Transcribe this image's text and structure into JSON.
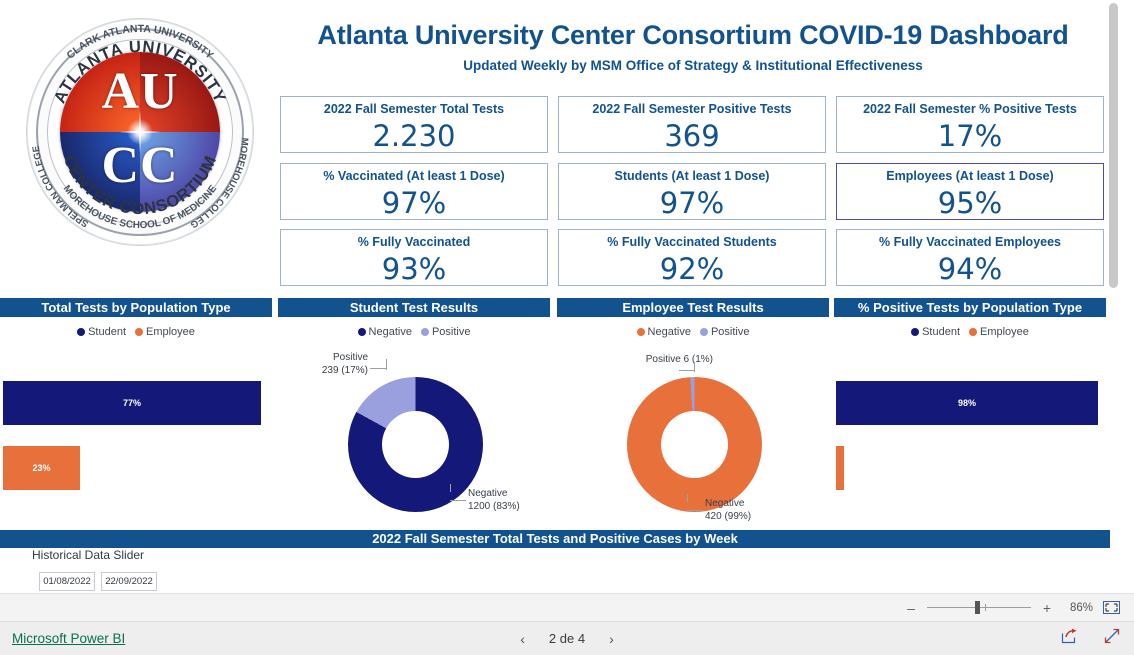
{
  "header": {
    "title": "Atlanta University Center Consortium COVID-19 Dashboard",
    "subtitle": "Updated Weekly by MSM Office of Strategy & Institutional Effectiveness"
  },
  "logo": {
    "inner_text_top": "ATLANTA UNIVERSITY",
    "inner_text_bottom": "CENTER CONSORTIUM",
    "outer_text_top": "CLARK ATLANTA UNIVERSITY",
    "outer_text_left": "SPELMAN COLLEGE",
    "outer_text_right": "MOREHOUSE COLLEGE",
    "outer_text_bottom": "MOREHOUSE SCHOOL OF MEDICINE",
    "monogram_line1": "AU",
    "monogram_line2": "CC"
  },
  "kpis": [
    {
      "label": "2022 Fall Semester Total Tests",
      "value": "2.230",
      "focused": false
    },
    {
      "label": "2022 Fall Semester Positive Tests",
      "value": "369",
      "focused": false
    },
    {
      "label": "2022 Fall Semester % Positive Tests",
      "value": "17%",
      "focused": false
    },
    {
      "label": "% Vaccinated (At least 1 Dose)",
      "value": "97%",
      "focused": false
    },
    {
      "label": "Students (At least 1 Dose)",
      "value": "97%",
      "focused": false
    },
    {
      "label": "Employees (At least 1 Dose)",
      "value": "95%",
      "focused": true
    },
    {
      "label": "% Fully Vaccinated",
      "value": "93%",
      "focused": false
    },
    {
      "label": "% Fully Vaccinated Students",
      "value": "92%",
      "focused": false
    },
    {
      "label": "% Fully Vaccinated Employees",
      "value": "94%",
      "focused": false
    }
  ],
  "panels": {
    "total_tests_by_population": "Total Tests by Population Type",
    "student_test_results": "Student Test Results",
    "employee_test_results": "Employee Test Results",
    "pct_positive_by_population": "% Positive Tests by Population Type",
    "weekly_trend": "2022 Fall Semester Total Tests and Positive Cases by Week"
  },
  "slider": {
    "label": "Historical Data Slider",
    "start_date": "01/08/2022",
    "end_date": "22/09/2022"
  },
  "zoombar": {
    "minus": "–",
    "plus": "+",
    "percent": "86%",
    "fit_icon": "fit-to-page-icon"
  },
  "footer": {
    "brand": "Microsoft Power BI",
    "prev_icon": "chevron-left-icon",
    "page_indicator": "2 de 4",
    "next_icon": "chevron-right-icon",
    "share_icon": "share-icon",
    "fullscreen_icon": "fullscreen-icon"
  },
  "colors": {
    "header_blue": "#11528f",
    "navy": "#141878",
    "orange": "#E8703A",
    "light_purple": "#9aa0dd",
    "card_border": "#9db3cc",
    "focus_border": "#4b4f9e"
  },
  "chart_data": [
    {
      "type": "bar",
      "title": "Total Tests by Population Type",
      "orientation": "horizontal",
      "categories": [
        "Student",
        "Employee"
      ],
      "values": [
        77,
        23
      ],
      "labels": [
        "77%",
        "23%"
      ],
      "colors": [
        "#141878",
        "#E8703A"
      ],
      "legend": [
        {
          "label": "Student",
          "color": "#141878"
        },
        {
          "label": "Employee",
          "color": "#E8703A"
        }
      ],
      "legend_position": "top",
      "xlabel": "",
      "ylabel": "",
      "xlim": [
        0,
        100
      ],
      "grid": false
    },
    {
      "type": "pie",
      "subtype": "donut",
      "title": "Student Test Results",
      "categories": [
        "Negative",
        "Positive"
      ],
      "values": [
        1200,
        239
      ],
      "percents": [
        83,
        17
      ],
      "data_labels": [
        "Negative\n1200 (83%)",
        "Positive\n239 (17%)"
      ],
      "colors": [
        "#141878",
        "#9aa0dd"
      ],
      "legend": [
        {
          "label": "Negative",
          "color": "#141878"
        },
        {
          "label": "Positive",
          "color": "#9aa0dd"
        }
      ],
      "legend_position": "top"
    },
    {
      "type": "pie",
      "subtype": "donut",
      "title": "Employee Test Results",
      "categories": [
        "Negative",
        "Positive"
      ],
      "values": [
        420,
        6
      ],
      "percents": [
        99,
        1
      ],
      "data_labels": [
        "Negative\n420 (99%)",
        "Positive 6 (1%)"
      ],
      "colors": [
        "#E8703A",
        "#9aa0dd"
      ],
      "legend": [
        {
          "label": "Negative",
          "color": "#E8703A"
        },
        {
          "label": "Positive",
          "color": "#9aa0dd"
        }
      ],
      "legend_position": "top"
    },
    {
      "type": "bar",
      "title": "% Positive Tests by Population Type",
      "orientation": "horizontal",
      "categories": [
        "Student",
        "Employee"
      ],
      "values": [
        98,
        2
      ],
      "labels": [
        "98%",
        ""
      ],
      "colors": [
        "#141878",
        "#E8703A"
      ],
      "legend": [
        {
          "label": "Student",
          "color": "#141878"
        },
        {
          "label": "Employee",
          "color": "#E8703A"
        }
      ],
      "legend_position": "top",
      "xlabel": "",
      "ylabel": "",
      "xlim": [
        0,
        100
      ],
      "grid": false
    }
  ]
}
